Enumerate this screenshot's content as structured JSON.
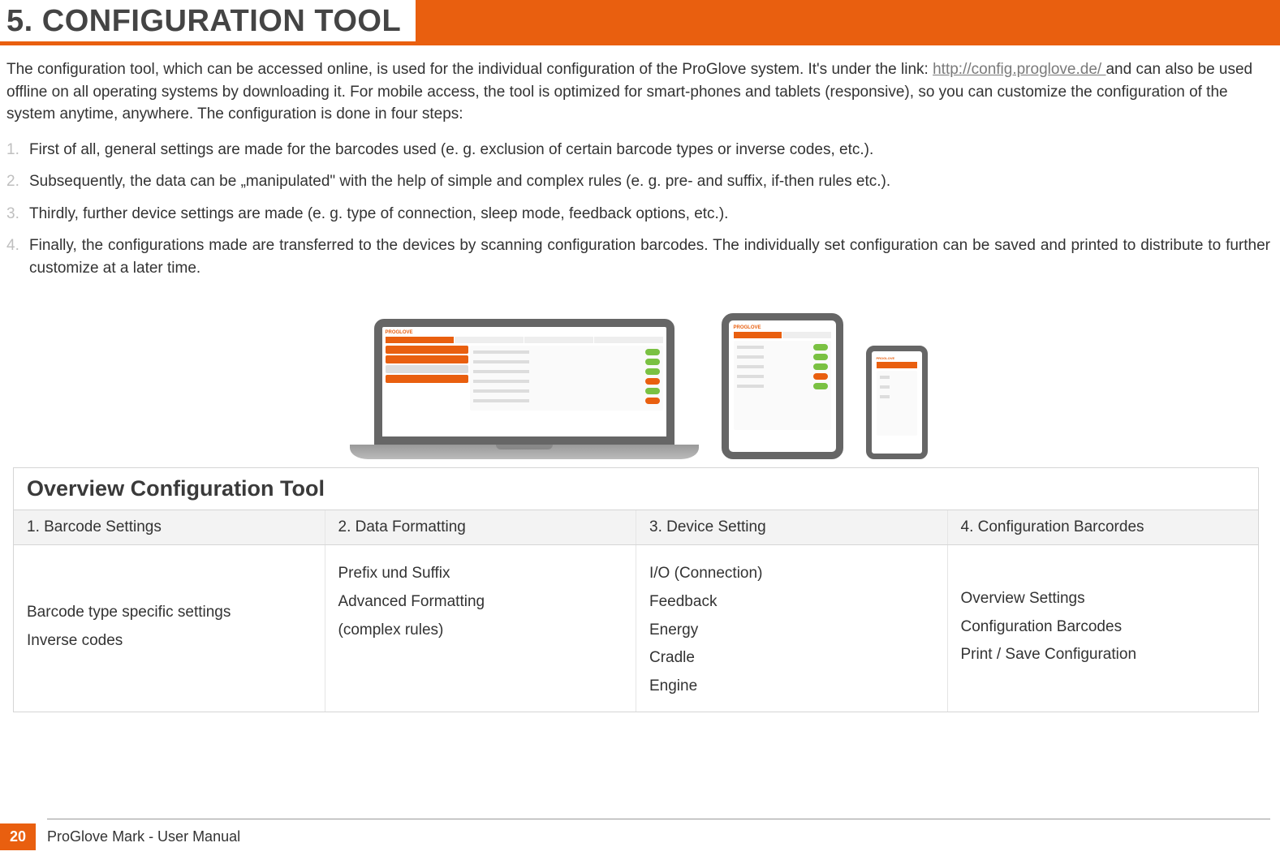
{
  "header": {
    "title": "5. CONFIGURATION TOOL"
  },
  "intro": {
    "part1": "The configuration tool, which can be accessed online, is used for the individual configuration of the ProGlove system. It's under the link: ",
    "link_text": "http://config.proglove.de/ ",
    "part2": "and can also be used offline on all operating systems by downloading it. For mobile access, the tool is optimized for smart-phones and tablets (responsive), so you can customize the configuration of the system anytime, anywhere. The configuration is done in four steps:"
  },
  "steps": [
    {
      "num": "1.",
      "text": "First of all, general settings are made for the barcodes used (e. g. exclusion of certain barcode types or inverse codes, etc.)."
    },
    {
      "num": "2.",
      "text": "Subsequently, the data can be „manipulated\" with the help of simple and complex rules (e. g. pre- and suffix, if-then rules etc.)."
    },
    {
      "num": "3.",
      "text": "Thirdly, further device settings are made (e. g. type of connection, sleep mode, feedback options, etc.)."
    },
    {
      "num": "4.",
      "text": "Finally, the configurations made are transferred to the devices by scanning configuration barcodes. The individually set configuration can be saved and printed to distribute to further customize at a later time."
    }
  ],
  "devices": {
    "mini_logo": "PROGLOVE"
  },
  "overview": {
    "title": "Overview Configuration Tool",
    "columns": [
      {
        "header": "1. Barcode Settings",
        "items": [
          "Barcode type specific settings",
          "Inverse codes"
        ]
      },
      {
        "header": "2. Data Formatting",
        "items": [
          "Prefix und Suffix",
          "Advanced Formatting",
          "(complex rules)"
        ]
      },
      {
        "header": "3. Device Setting",
        "items": [
          "I/O (Connection)",
          "Feedback",
          "Energy",
          "Cradle",
          "Engine"
        ]
      },
      {
        "header": "4. Configuration Barcordes",
        "items": [
          "Overview Settings",
          "Configuration Barcodes",
          "Print / Save Configuration"
        ]
      }
    ]
  },
  "footer": {
    "page": "20",
    "manual": "ProGlove Mark - User Manual"
  }
}
